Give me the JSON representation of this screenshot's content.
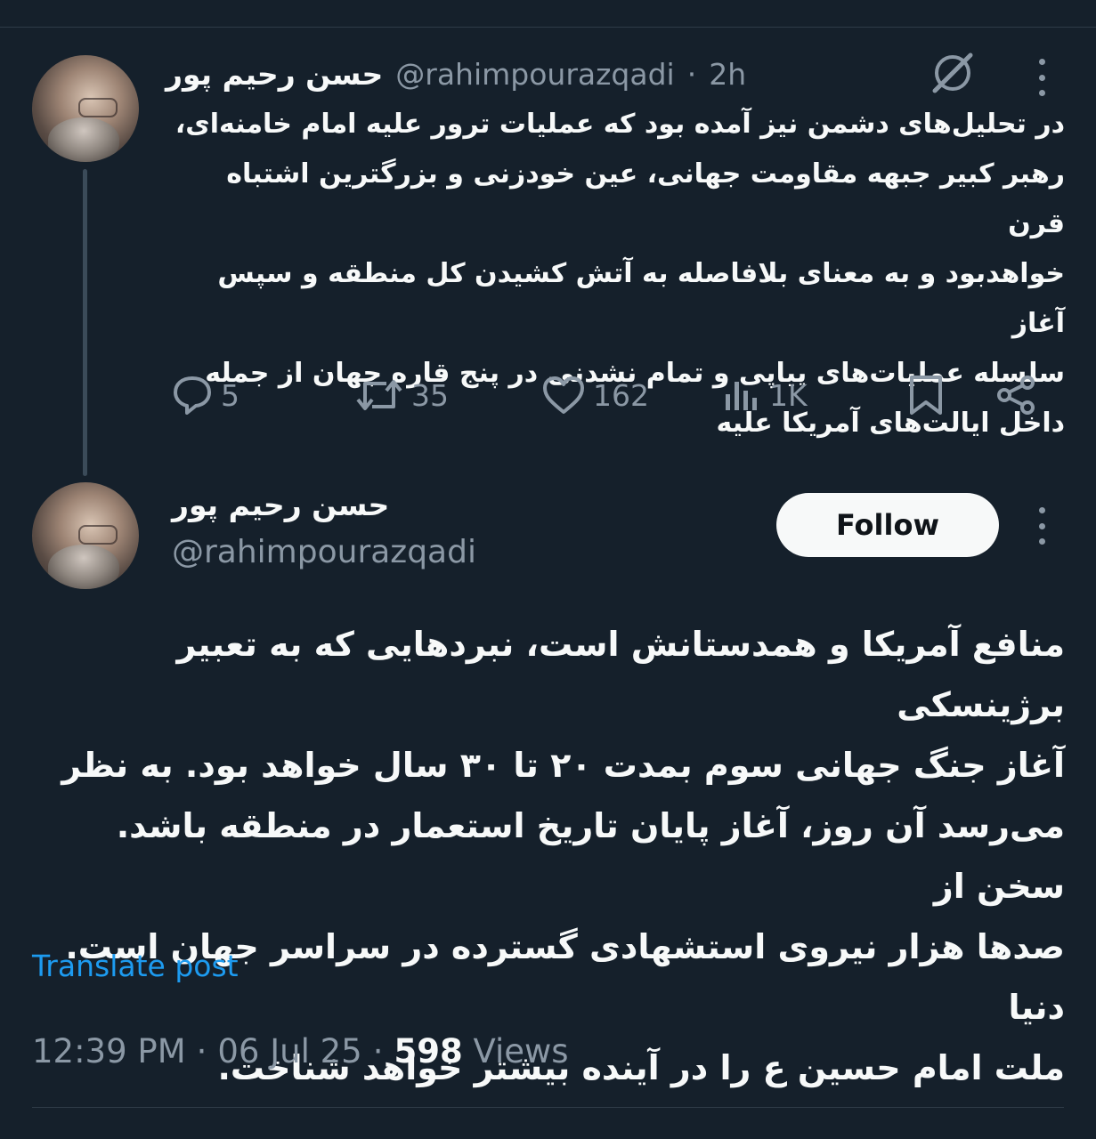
{
  "tweet1": {
    "display_name": "حسن رحیم پور",
    "handle": "@rahimpourazqadi",
    "separator": "·",
    "time_ago": "2h",
    "text": "در تحلیل‌های دشمن نیز آمده بود که عملیات ترور علیه امام خامنه‌ای،\nرهبر کبیر جبهه مقاومت جهانی، عین خودزنی و بزرگترین اشتباه قرن\nخواهدبود و به معنای بلافاصله به آتش کشیدن کل منطقه و سپس آغاز\nسلسله عملیات‌های پیاپی و تمام نشدنی در پنج قاره جهان از جمله\nداخل ایالت‌های آمریکا علیه",
    "actions": {
      "replies": "5",
      "reposts": "35",
      "likes": "162",
      "views": "1K"
    }
  },
  "tweet2": {
    "display_name": "حسن رحیم پور",
    "handle": "@rahimpourazqadi",
    "follow_label": "Follow",
    "text": "منافع آمریکا و همدستانش است، نبردهایی که به تعبیر برژینسکی\nآغاز جنگ جهانی سوم بمدت ۲۰ تا ۳۰ سال خواهد بود. به نظر\nمی‌رسد آن روز، آغاز پایان تاریخ استعمار در منطقه باشد. سخن از\nصدها هزار نیروی استشهادی گسترده در سراسر جهان است. دنیا\nملت امام حسین ع را در آینده بیشتر خواهد شناخت.",
    "translate_label": "Translate post",
    "time": "12:39 PM",
    "date": "06 Jul 25",
    "views_count": "598",
    "views_label": "Views",
    "dot": "·"
  },
  "colors": {
    "background": "#15202b",
    "text_primary": "#f7f9f9",
    "text_secondary": "#8b98a5",
    "link": "#1d9bf0",
    "divider": "#2f3b47"
  }
}
